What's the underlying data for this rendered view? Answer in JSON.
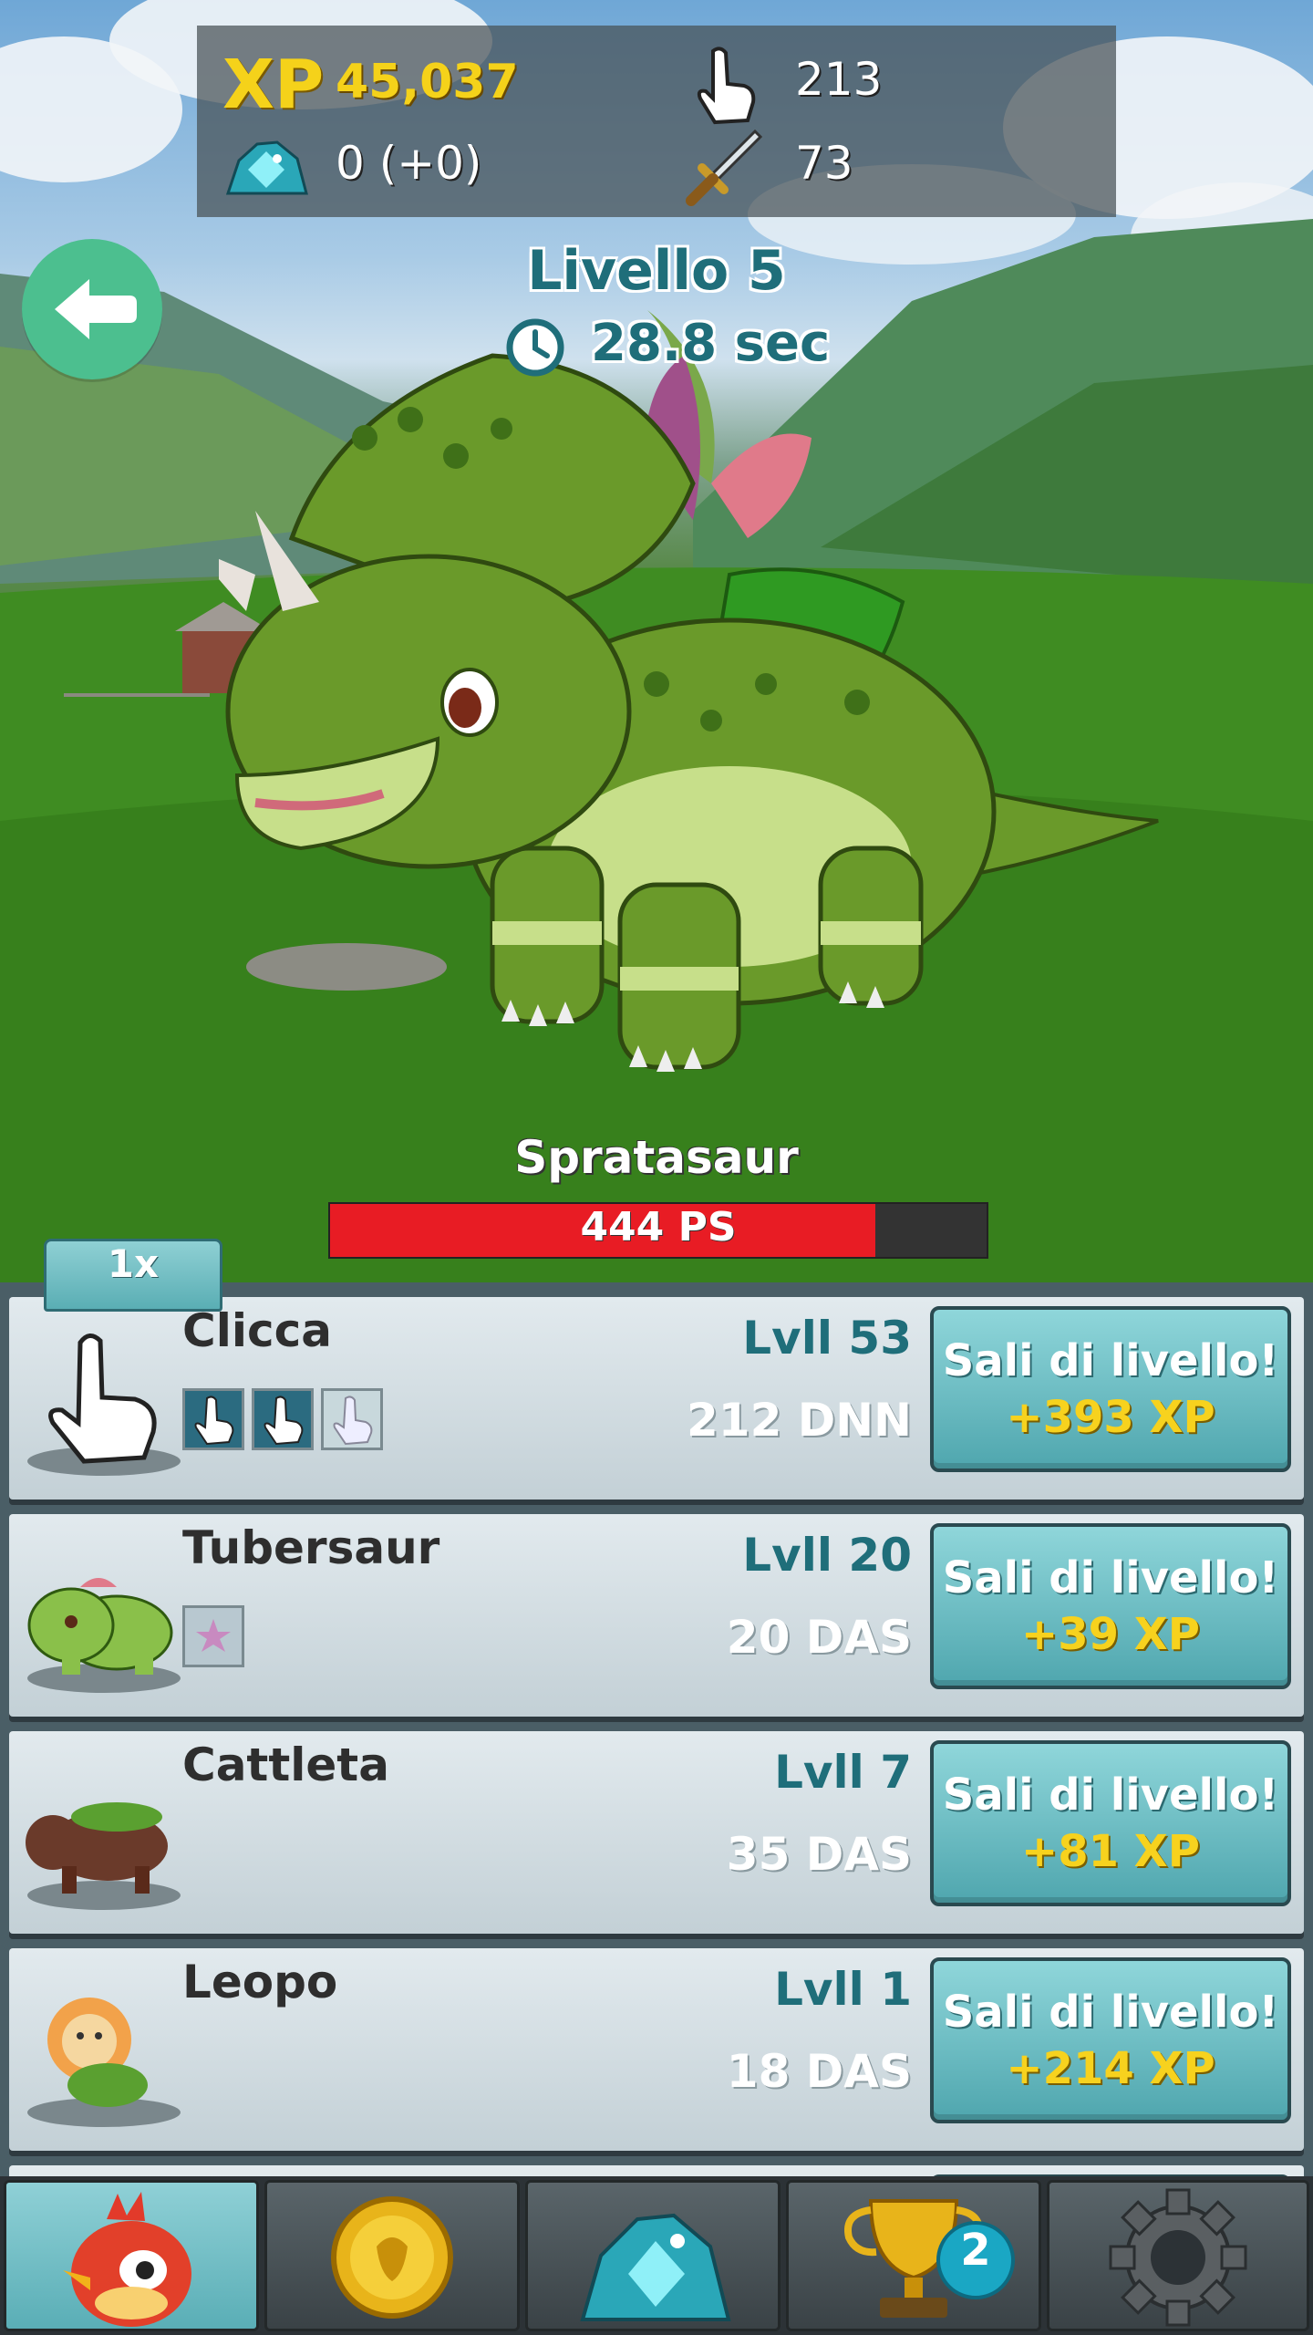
{
  "hud": {
    "xp_label": "XP",
    "xp_value": "45,037",
    "gems_value": "0 (+0)",
    "taps_value": "213",
    "attack_value": "73"
  },
  "stage": {
    "level_label": "Livello 5",
    "timer_label": "28.8 sec"
  },
  "monster": {
    "name": "Spratasaur",
    "hp_label": "444 PS",
    "hp_fraction": 0.83
  },
  "multiplier_tab": "1x",
  "upgrades": [
    {
      "name": "Clicca",
      "level": "Lvll 53",
      "dps": "212 DNN",
      "button_line1": "Sali di livello!",
      "button_line2": "+393 XP"
    },
    {
      "name": "Tubersaur",
      "level": "Lvll 20",
      "dps": "20 DAS",
      "button_line1": "Sali di livello!",
      "button_line2": "+39 XP"
    },
    {
      "name": "Cattleta",
      "level": "Lvll 7",
      "dps": "35 DAS",
      "button_line1": "Sali di livello!",
      "button_line2": "+81 XP"
    },
    {
      "name": "Leopo",
      "level": "Lvll 1",
      "dps": "18 DAS",
      "button_line1": "Sali di livello!",
      "button_line2": "+214 XP"
    }
  ],
  "nav": {
    "items": [
      {
        "icon": "bird-icon"
      },
      {
        "icon": "coin-icon"
      },
      {
        "icon": "gems-icon"
      },
      {
        "icon": "trophy-icon",
        "badge": "2"
      },
      {
        "icon": "gear-icon"
      }
    ]
  },
  "colors": {
    "xp_yellow": "#f5d21a",
    "teal_text": "#1f6e7a",
    "hp_red": "#e81c24",
    "back_green": "#4cbf8f",
    "button_teal": "#5aaeb4"
  }
}
